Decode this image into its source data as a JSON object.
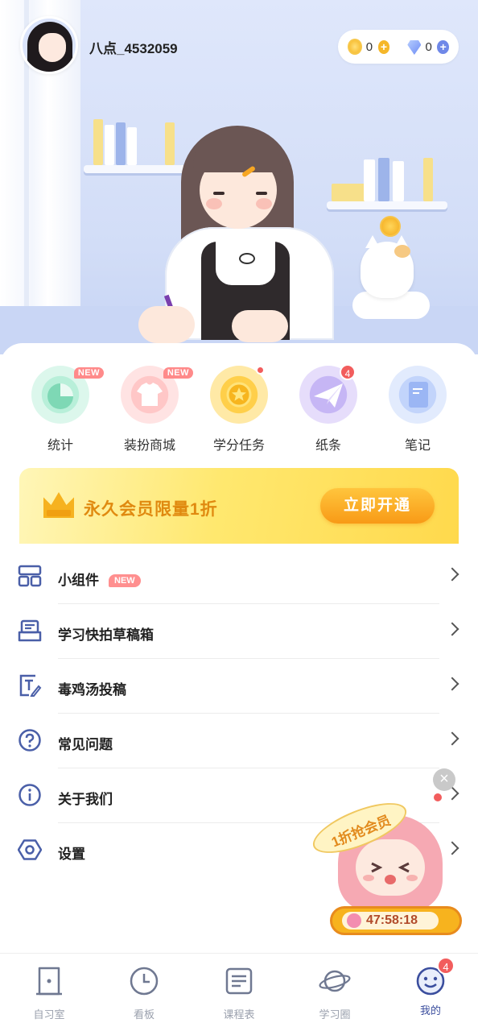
{
  "profile": {
    "username": "八点_4532059"
  },
  "wallet": {
    "coins": "0",
    "diamonds": "0"
  },
  "quick_actions": [
    {
      "label": "统计",
      "badge": "NEW",
      "icon": "chart-pie-icon"
    },
    {
      "label": "装扮商城",
      "badge": "NEW",
      "icon": "tshirt-icon"
    },
    {
      "label": "学分任务",
      "badge_dot": true,
      "icon": "star-coin-icon"
    },
    {
      "label": "纸条",
      "badge_count": "4",
      "icon": "paper-plane-icon"
    },
    {
      "label": "笔记",
      "icon": "notebook-icon"
    }
  ],
  "vip_banner": {
    "text": "永久会员限量1折",
    "button": "立即开通"
  },
  "menu": [
    {
      "label": "小组件",
      "badge": "NEW",
      "icon": "widgets-icon"
    },
    {
      "label": "学习快拍草稿箱",
      "icon": "drafts-icon"
    },
    {
      "label": "毒鸡汤投稿",
      "icon": "text-edit-icon"
    },
    {
      "label": "常见问题",
      "icon": "question-circle-icon"
    },
    {
      "label": "关于我们",
      "icon": "info-circle-icon",
      "badge_dot": true
    },
    {
      "label": "设置",
      "icon": "hexagon-settings-icon"
    }
  ],
  "promo": {
    "tag": "1折抢会员",
    "countdown": "47:58:18"
  },
  "tabs": [
    {
      "label": "自习室",
      "icon": "study-room-icon"
    },
    {
      "label": "看板",
      "icon": "clock-icon"
    },
    {
      "label": "课程表",
      "icon": "schedule-icon"
    },
    {
      "label": "学习圈",
      "icon": "planet-icon"
    },
    {
      "label": "我的",
      "icon": "smile-face-icon",
      "active": true,
      "badge_count": "4"
    }
  ],
  "colors": {
    "accent": "#4a5fa8",
    "badge_red": "#f25d5d",
    "vip_gold": "#f89a16"
  }
}
